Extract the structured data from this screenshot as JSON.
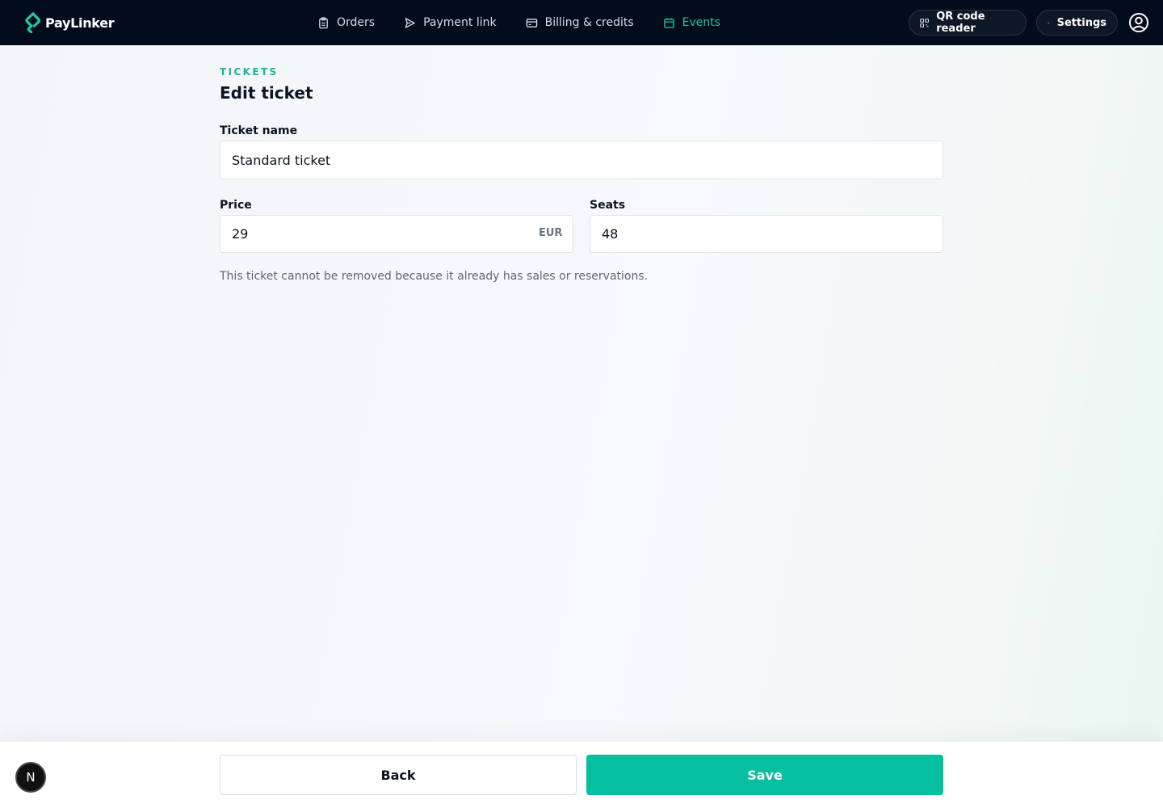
{
  "app": {
    "name": "PayLinker",
    "brand_color": "#20c3a6"
  },
  "nav": {
    "items": [
      {
        "label": "Orders",
        "icon": "clipboard-icon"
      },
      {
        "label": "Payment link",
        "icon": "send-icon"
      },
      {
        "label": "Billing & credits",
        "icon": "credit-card-icon"
      },
      {
        "label": "Events",
        "icon": "calendar-icon",
        "active": true
      }
    ]
  },
  "header_actions": {
    "qr_label": "QR code reader",
    "settings_label": "Settings"
  },
  "page": {
    "section": "TICKETS",
    "title": "Edit ticket"
  },
  "form": {
    "ticket_name_label": "Ticket name",
    "ticket_name_value": "Standard ticket",
    "price_label": "Price",
    "price_value": "29",
    "price_currency": "EUR",
    "seats_label": "Seats",
    "seats_value": "48",
    "notice": "This ticket cannot be removed because it already has sales or reservations."
  },
  "footer": {
    "back_label": "Back",
    "save_label": "Save",
    "save_color": "#06bfa0"
  },
  "dev_badge": {
    "letter": "N"
  }
}
